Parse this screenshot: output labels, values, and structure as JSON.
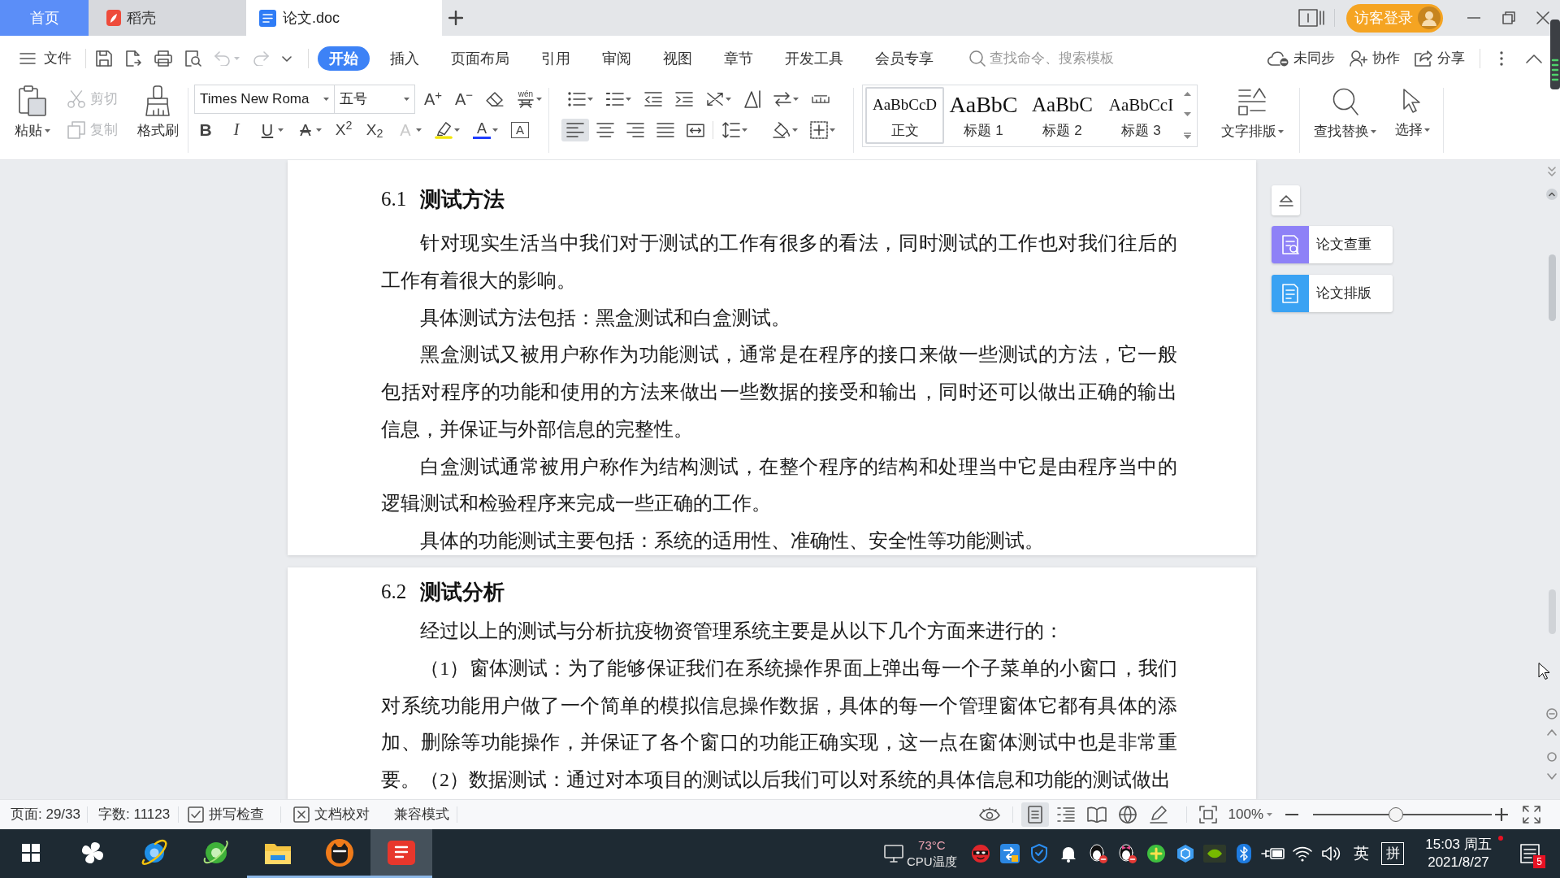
{
  "tab_bar": {
    "tabs": [
      {
        "label": "首页",
        "kind": "home",
        "selected": false
      },
      {
        "label": "稻壳",
        "kind": "docer",
        "selected": false
      },
      {
        "label": "论文.doc",
        "kind": "document",
        "selected": true
      }
    ],
    "login": "访客登录"
  },
  "menu_bar": {
    "file": "文件",
    "quick_access": [
      {
        "kind": "save",
        "disabled": false,
        "dropdown": false
      },
      {
        "kind": "export",
        "disabled": false,
        "dropdown": false
      },
      {
        "kind": "print",
        "disabled": false,
        "dropdown": false
      },
      {
        "kind": "preview",
        "disabled": false,
        "dropdown": false
      },
      {
        "kind": "undo",
        "disabled": true,
        "dropdown": true
      },
      {
        "kind": "redo",
        "disabled": true,
        "dropdown": false
      },
      {
        "kind": "customize",
        "disabled": false,
        "dropdown": false
      }
    ],
    "tabs": [
      {
        "label": "开始",
        "selected": true
      },
      {
        "label": "插入",
        "selected": false
      },
      {
        "label": "页面布局",
        "selected": false
      },
      {
        "label": "引用",
        "selected": false
      },
      {
        "label": "审阅",
        "selected": false
      },
      {
        "label": "视图",
        "selected": false
      },
      {
        "label": "章节",
        "selected": false
      },
      {
        "label": "开发工具",
        "selected": false
      },
      {
        "label": "会员专享",
        "selected": false
      }
    ],
    "search": {
      "placeholder": "查找命令、搜索模板"
    },
    "actions": [
      {
        "kind": "sync",
        "label": "未同步"
      },
      {
        "kind": "collaborate",
        "label": "协作"
      },
      {
        "kind": "share",
        "label": "分享"
      }
    ]
  },
  "ribbon": {
    "clipboard": [
      {
        "kind": "paste",
        "label": "粘贴",
        "disabled": false,
        "dropdown": true
      },
      {
        "kind": "cut",
        "label": "剪切",
        "disabled": true,
        "dropdown": false
      },
      {
        "kind": "copy",
        "label": "复制",
        "disabled": true,
        "dropdown": false
      },
      {
        "kind": "format_painter",
        "label": "格式刷",
        "disabled": false,
        "dropdown": false
      }
    ],
    "font": {
      "name": "Times New Roma",
      "size": "五号"
    },
    "font_tools": [
      {
        "kind": "grow",
        "label": "A$^{+}$",
        "dropdown": false
      },
      {
        "kind": "shrink",
        "label": "A$^{−}$",
        "dropdown": false
      },
      {
        "kind": "clear",
        "dropdown": false
      },
      {
        "kind": "pinyin",
        "label": "wén",
        "dropdown": true
      }
    ],
    "format_tools": [
      {
        "kind": "bold",
        "label": "B",
        "dropdown": false
      },
      {
        "kind": "italic",
        "label": "I",
        "dropdown": false
      },
      {
        "kind": "underline",
        "label": "U",
        "dropdown": true
      },
      {
        "kind": "strikethrough",
        "label": "A",
        "dropdown": true
      },
      {
        "kind": "superscript",
        "label": "X$^{2}$",
        "dropdown": false
      },
      {
        "kind": "subscript",
        "label": "X$_{2}$",
        "dropdown": false
      },
      {
        "kind": "effects",
        "label": "A",
        "dropdown": true
      },
      {
        "kind": "highlight",
        "dropdown": true
      },
      {
        "kind": "font_color",
        "label": "A",
        "dropdown": true
      },
      {
        "kind": "char_border",
        "label": "A",
        "dropdown": false
      }
    ],
    "paragraph_tools": [
      {
        "kind": "bullets",
        "dropdown": true
      },
      {
        "kind": "numbering",
        "dropdown": true
      },
      {
        "kind": "outdent",
        "dropdown": false
      },
      {
        "kind": "indent",
        "dropdown": false
      },
      {
        "kind": "cn_layout",
        "dropdown": true
      },
      {
        "kind": "sort",
        "dropdown": false
      },
      {
        "kind": "direction",
        "dropdown": true
      },
      {
        "kind": "tab_stops",
        "dropdown": false
      }
    ],
    "align_tools": [
      {
        "kind": "align_left",
        "selected": true,
        "dropdown": false
      },
      {
        "kind": "align_center",
        "selected": false,
        "dropdown": false
      },
      {
        "kind": "align_right",
        "selected": false,
        "dropdown": false
      },
      {
        "kind": "justify",
        "selected": false,
        "dropdown": false
      },
      {
        "kind": "distribute",
        "selected": false,
        "dropdown": false
      },
      {
        "kind": "line_spacing",
        "selected": false,
        "dropdown": true
      },
      {
        "kind": "shading",
        "selected": false,
        "dropdown": true
      },
      {
        "kind": "borders",
        "selected": false,
        "dropdown": true
      }
    ],
    "styles": [
      {
        "kind": "body",
        "preview": "AaBbCcD",
        "label": "正文",
        "selected": true
      },
      {
        "kind": "heading1",
        "preview": "AaBbC",
        "label": "标题 1",
        "selected": false
      },
      {
        "kind": "heading2",
        "preview": "AaBbC",
        "label": "标题 2",
        "selected": false
      },
      {
        "kind": "heading3",
        "preview": "AaBbCcI",
        "label": "标题 3",
        "selected": false
      }
    ],
    "big_tools": [
      {
        "kind": "text_layout",
        "label": "文字排版",
        "dropdown": true
      },
      {
        "kind": "find_replace",
        "label": "查找替换",
        "dropdown": true
      },
      {
        "kind": "select",
        "label": "选择",
        "dropdown": true
      }
    ]
  },
  "document": {
    "pages": [
      {
        "heading": {
          "number": "6.1",
          "title": "测试方法"
        },
        "paragraphs": [
          "针对现实生活当中我们对于测试的工作有很多的看法，同时测试的工作也对我们往后的工作有着很大的影响。",
          "具体测试方法包括：黑盒测试和白盒测试。",
          "黑盒测试又被用户称作为功能测试，通常是在程序的接口来做一些测试的方法，它一般包括对程序的功能和使用的方法来做出一些数据的接受和输出，同时还可以做出正确的输出信息，并保证与外部信息的完整性。",
          "白盒测试通常被用户称作为结构测试，在整个程序的结构和处理当中它是由程序当中的逻辑测试和检验程序来完成一些正确的工作。",
          "具体的功能测试主要包括：系统的适用性、准确性、安全性等功能测试。"
        ]
      },
      {
        "heading": {
          "number": "6.2",
          "title": "测试分析"
        },
        "paragraphs": [
          "经过以上的测试与分析抗疫物资管理系统主要是从以下几个方面来进行的：",
          "（1）窗体测试：为了能够保证我们在系统操作界面上弹出每一个子菜单的小窗口，我们对系统功能用户做了一个简单的模拟信息操作数据，具体的每一个管理窗体它都有具体的添加、删除等功能操作，并保证了各个窗口的功能正确实现，这一点在窗体测试中也是非常重要。（2）数据测试：通过对本项目的测试以后我们可以对系统的具体信息和功能的测试做出"
        ]
      }
    ]
  },
  "side_panel": {
    "items": [
      {
        "kind": "check",
        "label": "论文查重"
      },
      {
        "kind": "layout",
        "label": "论文排版"
      }
    ]
  },
  "status_bar": {
    "page": "页面: 29/33",
    "words": "字数: 11123",
    "checks": [
      {
        "kind": "spellcheck",
        "label": "拼写检查"
      },
      {
        "kind": "proofread",
        "label": "文档校对"
      }
    ],
    "mode": "兼容模式",
    "views": [
      {
        "kind": "eye_care",
        "selected": false
      },
      {
        "kind": "page",
        "selected": true
      },
      {
        "kind": "outline",
        "selected": false
      },
      {
        "kind": "reading",
        "selected": false
      },
      {
        "kind": "web",
        "selected": false
      },
      {
        "kind": "write",
        "selected": false
      }
    ],
    "zoom": {
      "label": "100%",
      "level": 0.46
    }
  },
  "taskbar": {
    "apps": [
      {
        "kind": "start",
        "running": false,
        "active": false
      },
      {
        "kind": "pinwheel",
        "running": false,
        "active": false
      },
      {
        "kind": "ie",
        "running": false,
        "active": false
      },
      {
        "kind": "browser",
        "running": false,
        "active": false
      },
      {
        "kind": "explorer",
        "running": true,
        "active": false
      },
      {
        "kind": "cat",
        "running": true,
        "active": false
      },
      {
        "kind": "wps",
        "running": true,
        "active": true
      }
    ],
    "tray": {
      "temperature": "73°C",
      "temperature_label": "CPU温度",
      "icons": [
        {
          "kind": "mask"
        },
        {
          "kind": "transfer"
        },
        {
          "kind": "shield"
        },
        {
          "kind": "bell"
        },
        {
          "kind": "penguin"
        },
        {
          "kind": "penguin_alt"
        },
        {
          "kind": "plus"
        },
        {
          "kind": "cube"
        },
        {
          "kind": "gpu"
        },
        {
          "kind": "bluetooth"
        },
        {
          "kind": "power"
        },
        {
          "kind": "wifi"
        },
        {
          "kind": "volume"
        }
      ],
      "ime_language": "英",
      "ime_mode": "拼",
      "time": "15:03 周五",
      "date": "2021/8/27",
      "notifications": "5"
    }
  }
}
